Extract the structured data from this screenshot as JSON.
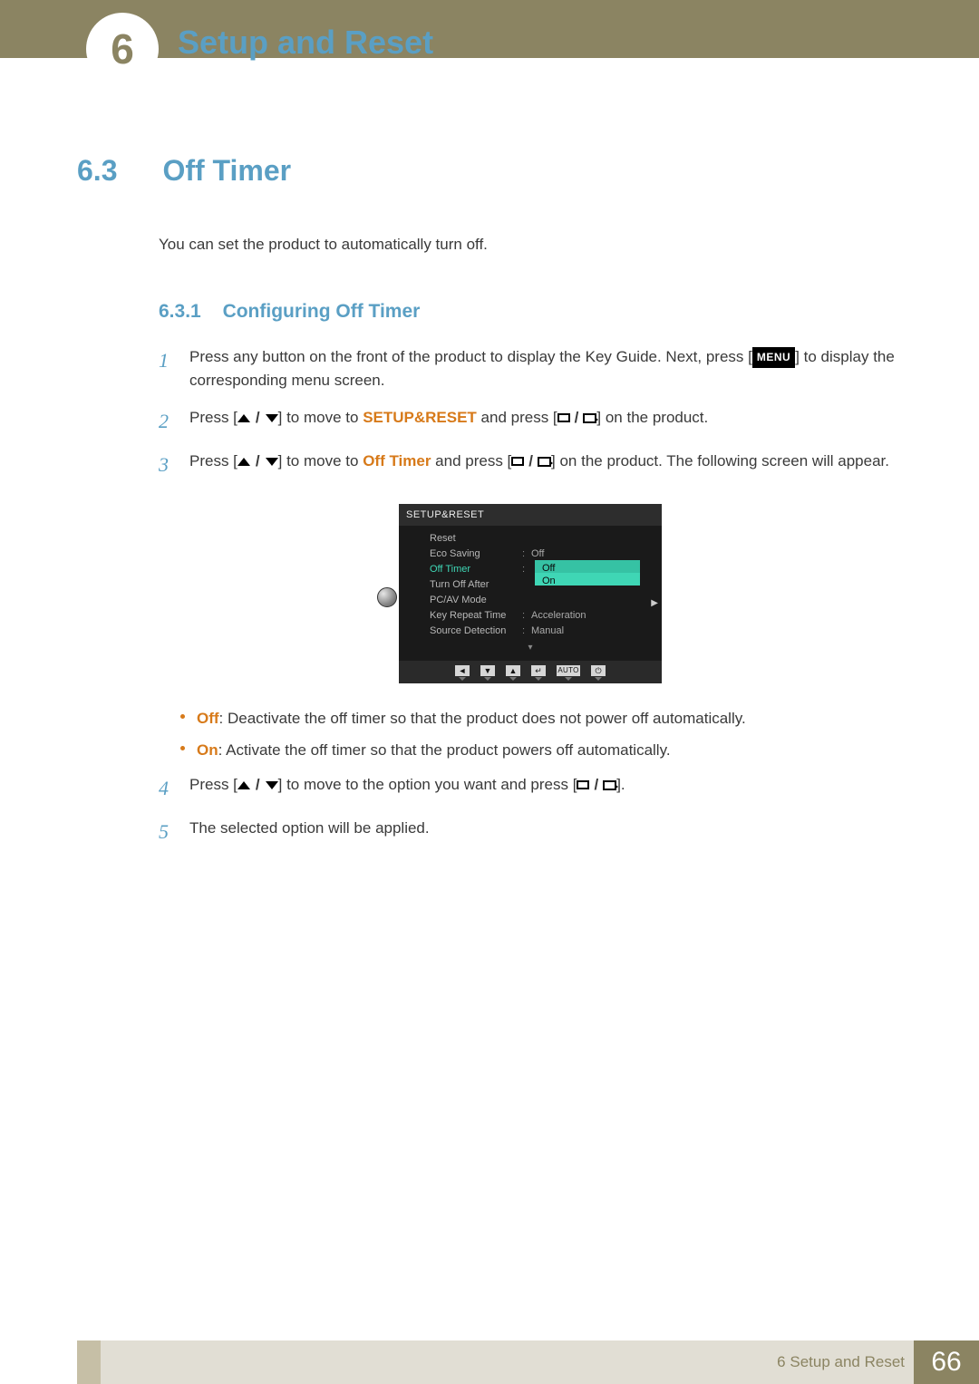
{
  "header": {
    "chapter_number": "6",
    "chapter_title": "Setup and Reset"
  },
  "section": {
    "number": "6.3",
    "title": "Off Timer",
    "intro": "You can set the product to automatically turn off.",
    "subsection": {
      "number": "6.3.1",
      "title": "Configuring Off Timer"
    }
  },
  "steps": {
    "s1_pre": "Press any button on the front of the product to display the Key Guide. Next, press [",
    "s1_menu": "MENU",
    "s1_post": "] to display the corresponding menu screen.",
    "s2_pre": "Press [",
    "s2_mid": "] to move to ",
    "s2_setup": "SETUP&RESET",
    "s2_and": " and press [",
    "s2_post": "] on the product.",
    "s3_pre": "Press [",
    "s3_mid": "] to move to ",
    "s3_off": "Off Timer",
    "s3_and": " and press [",
    "s3_post": "] on the product. The following screen will appear.",
    "s4_pre": "Press [",
    "s4_mid": "] to move to the option you want and press [",
    "s4_post": "].",
    "s5": "The selected option will be applied."
  },
  "bullets": {
    "off_label": "Off",
    "off_text": ": Deactivate the off timer so that the product does not power off automatically.",
    "on_label": "On",
    "on_text": ": Activate the off timer so that the product powers off automatically."
  },
  "osd": {
    "title": "SETUP&RESET",
    "rows": {
      "reset": "Reset",
      "eco": "Eco Saving",
      "eco_val": "Off",
      "offtimer": "Off Timer",
      "turnoff": "Turn Off After",
      "pcav": "PC/AV Mode",
      "keyrep": "Key Repeat Time",
      "keyrep_val": "Acceleration",
      "srcdet": "Source Detection",
      "srcdet_val": "Manual"
    },
    "popup": {
      "off": "Off",
      "on": "On"
    },
    "footer_auto": "AUTO"
  },
  "footer": {
    "label": "6 Setup and Reset",
    "page": "66"
  }
}
